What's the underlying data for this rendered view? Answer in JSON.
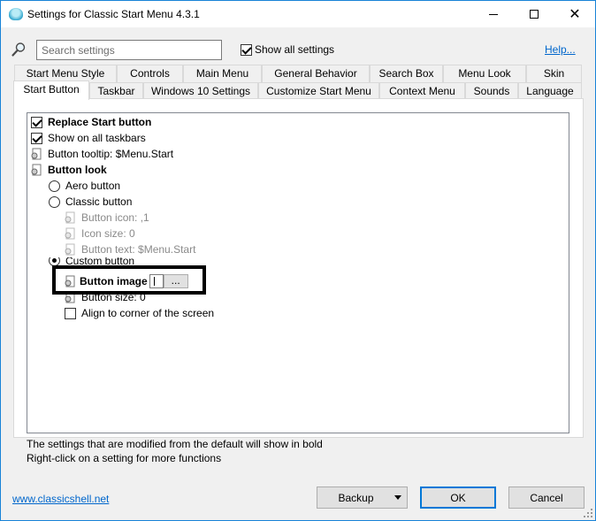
{
  "window": {
    "title": "Settings for Classic Start Menu 4.3.1",
    "minimize_icon": "minimize-icon",
    "maximize_icon": "maximize-icon",
    "close_glyph": "✕"
  },
  "search": {
    "placeholder": "Search settings",
    "value": "",
    "icon": "search-icon"
  },
  "show_all": {
    "label": "Show all settings",
    "checked": true
  },
  "help_link": "Help...",
  "tabs_row1": [
    "Start Menu Style",
    "Controls",
    "Main Menu",
    "General Behavior",
    "Search Box",
    "Menu Look",
    "Skin"
  ],
  "tabs_row2": [
    "Start Button",
    "Taskbar",
    "Windows 10 Settings",
    "Customize Start Menu",
    "Context Menu",
    "Sounds",
    "Language"
  ],
  "active_tab": "Start Button",
  "tree": {
    "replace_start": "Replace Start button",
    "show_all_taskbars": "Show on all taskbars",
    "button_tooltip": "Button tooltip: $Menu.Start",
    "button_look": "Button look",
    "aero_button": "Aero button",
    "classic_button": "Classic button",
    "button_icon": "Button icon: ,1",
    "icon_size": "Icon size: 0",
    "button_text": "Button text: $Menu.Start",
    "custom_button": "Custom button",
    "button_image": "Button image",
    "browse_label": "...",
    "button_size": "Button size: 0",
    "align_corner": "Align to corner of the screen"
  },
  "info": {
    "line1": "The settings that are modified from the default will show in bold",
    "line2": "Right-click on a setting for more functions"
  },
  "footer": {
    "site_link": "www.classicshell.net",
    "backup": "Backup",
    "ok": "OK",
    "cancel": "Cancel"
  },
  "colors": {
    "accent": "#0078d7",
    "link": "#0066cc",
    "disabled_text": "#8a8a8a"
  }
}
